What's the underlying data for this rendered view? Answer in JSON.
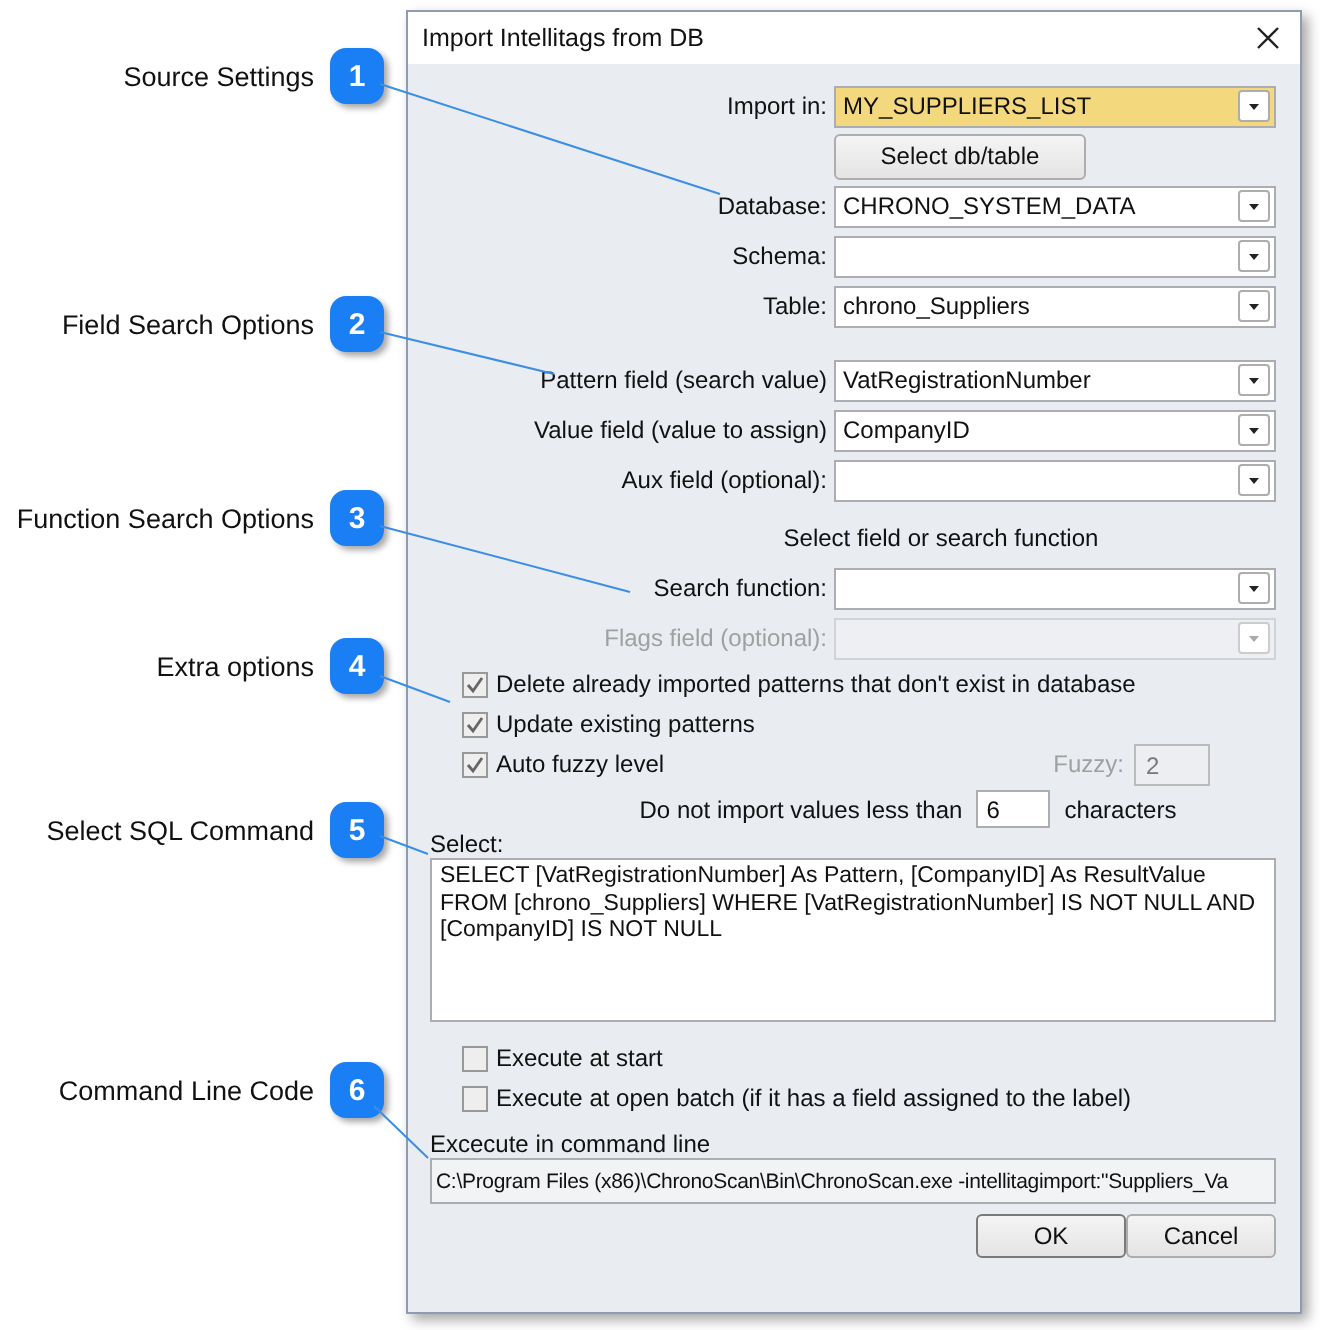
{
  "callouts": [
    {
      "number": "1",
      "label": "Source Settings"
    },
    {
      "number": "2",
      "label": "Field Search Options"
    },
    {
      "number": "3",
      "label": "Function Search Options"
    },
    {
      "number": "4",
      "label": "Extra options"
    },
    {
      "number": "5",
      "label": "Select SQL Command"
    },
    {
      "number": "6",
      "label": "Command Line Code"
    }
  ],
  "dialog": {
    "title": "Import Intellitags from DB",
    "field_groups": [
      [
        {
          "kind": "combo",
          "label": "Import in:",
          "value": "MY_SUPPLIERS_LIST",
          "highlighted": true,
          "disabled": false
        },
        {
          "kind": "button",
          "label": "Select db/table"
        },
        {
          "kind": "combo",
          "label": "Database:",
          "value": "CHRONO_SYSTEM_DATA",
          "highlighted": false,
          "disabled": false
        },
        {
          "kind": "combo",
          "label": "Schema:",
          "highlighted": false,
          "disabled": false
        },
        {
          "kind": "combo",
          "label": "Table:",
          "value": "chrono_Suppliers",
          "highlighted": false,
          "disabled": false
        }
      ],
      [
        {
          "kind": "combo",
          "label": "Pattern field (search value)",
          "value": "VatRegistrationNumber",
          "highlighted": false,
          "disabled": false
        },
        {
          "kind": "combo",
          "label": "Value field (value to assign)",
          "value": "CompanyID",
          "highlighted": false,
          "disabled": false
        },
        {
          "kind": "combo",
          "label": "Aux field (optional):",
          "highlighted": false,
          "disabled": false
        }
      ],
      [
        {
          "kind": "note",
          "label": "Select field or search function"
        },
        {
          "kind": "combo",
          "label": "Search function:",
          "highlighted": false,
          "disabled": false
        },
        {
          "kind": "combo",
          "label": "Flags field (optional):",
          "highlighted": false,
          "disabled": true
        }
      ]
    ],
    "options": [
      {
        "label": "Delete already imported patterns that don't exist in database",
        "checked": true
      },
      {
        "label": "Update existing patterns",
        "checked": true
      },
      {
        "label": "Auto fuzzy level",
        "checked": true
      }
    ],
    "fuzzy": {
      "label": "Fuzzy:",
      "value": "2",
      "disabled": true
    },
    "min_length": {
      "prefix": "Do not import values less than",
      "value": "6",
      "suffix": "characters"
    },
    "select": {
      "label": "Select:",
      "value": "SELECT [VatRegistrationNumber] As Pattern, [CompanyID] As ResultValue FROM [chrono_Suppliers] WHERE [VatRegistrationNumber] IS NOT NULL AND [CompanyID] IS NOT NULL"
    },
    "execute_options": [
      {
        "label": "Execute at start",
        "checked": false
      },
      {
        "label": "Execute at open batch (if it has a field assigned to the label)",
        "checked": false
      }
    ],
    "command": {
      "label": "Excecute in command line",
      "value": "C:\\Program Files (x86)\\ChronoScan\\Bin\\ChronoScan.exe -intellitagimport:\"Suppliers_Va"
    },
    "buttons": [
      "OK",
      "Cancel"
    ]
  }
}
